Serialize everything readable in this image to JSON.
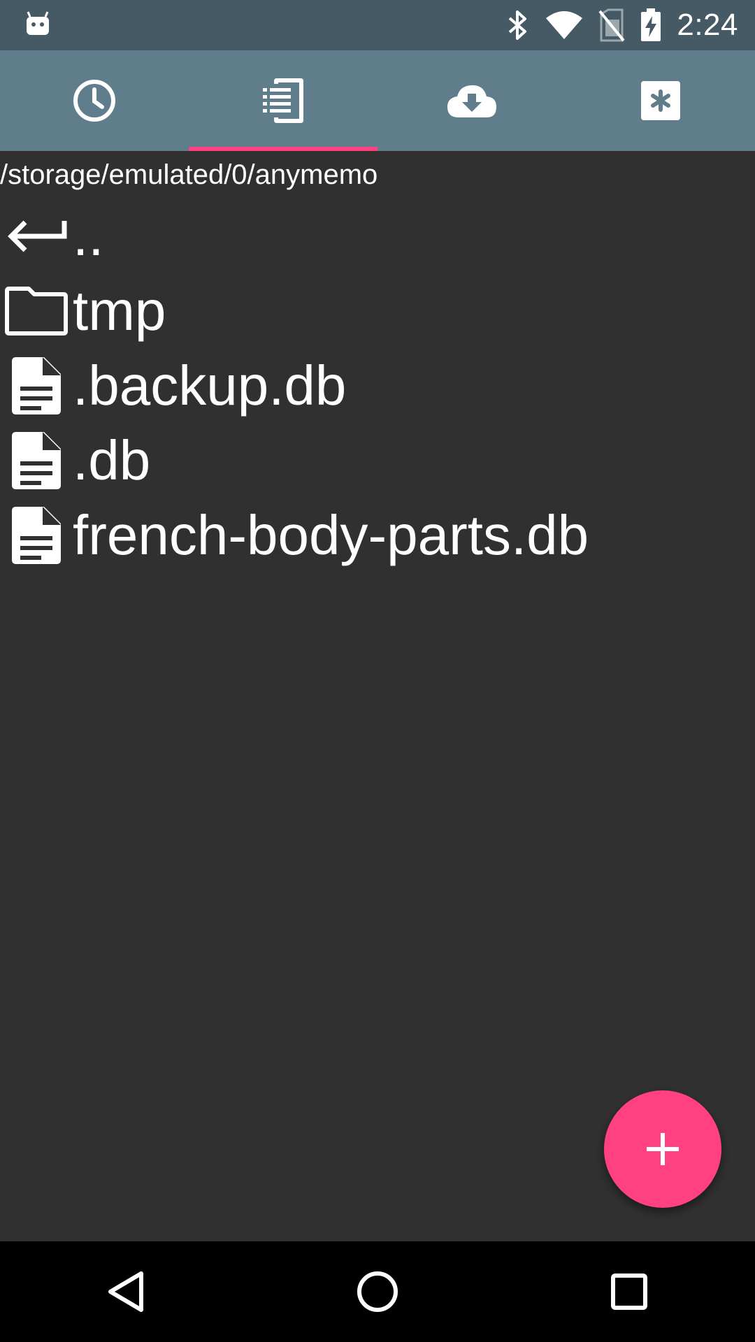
{
  "status_bar": {
    "time": "2:24",
    "icons": [
      "android-notification-icon",
      "bluetooth-icon",
      "wifi-icon",
      "no-sim-icon",
      "battery-charging-icon"
    ]
  },
  "tabs": [
    {
      "icon": "clock-icon",
      "selected": false
    },
    {
      "icon": "device-files-icon",
      "selected": true
    },
    {
      "icon": "cloud-download-icon",
      "selected": false
    },
    {
      "icon": "misc-asterisk-icon",
      "selected": false
    }
  ],
  "browser": {
    "path": "/storage/emulated/0/anymemo",
    "items": [
      {
        "name": "..",
        "type": "parent",
        "icon": "back-arrow-icon"
      },
      {
        "name": "tmp",
        "type": "folder",
        "icon": "folder-icon"
      },
      {
        "name": ".backup.db",
        "type": "file",
        "icon": "document-icon"
      },
      {
        "name": ".db",
        "type": "file",
        "icon": "document-icon"
      },
      {
        "name": "french-body-parts.db",
        "type": "file",
        "icon": "document-icon"
      }
    ]
  },
  "fab": {
    "icon": "plus-icon"
  },
  "colors": {
    "status_bar": "#455a64",
    "tab_bar": "#607d8b",
    "accent": "#ff4081",
    "background": "#303030"
  }
}
